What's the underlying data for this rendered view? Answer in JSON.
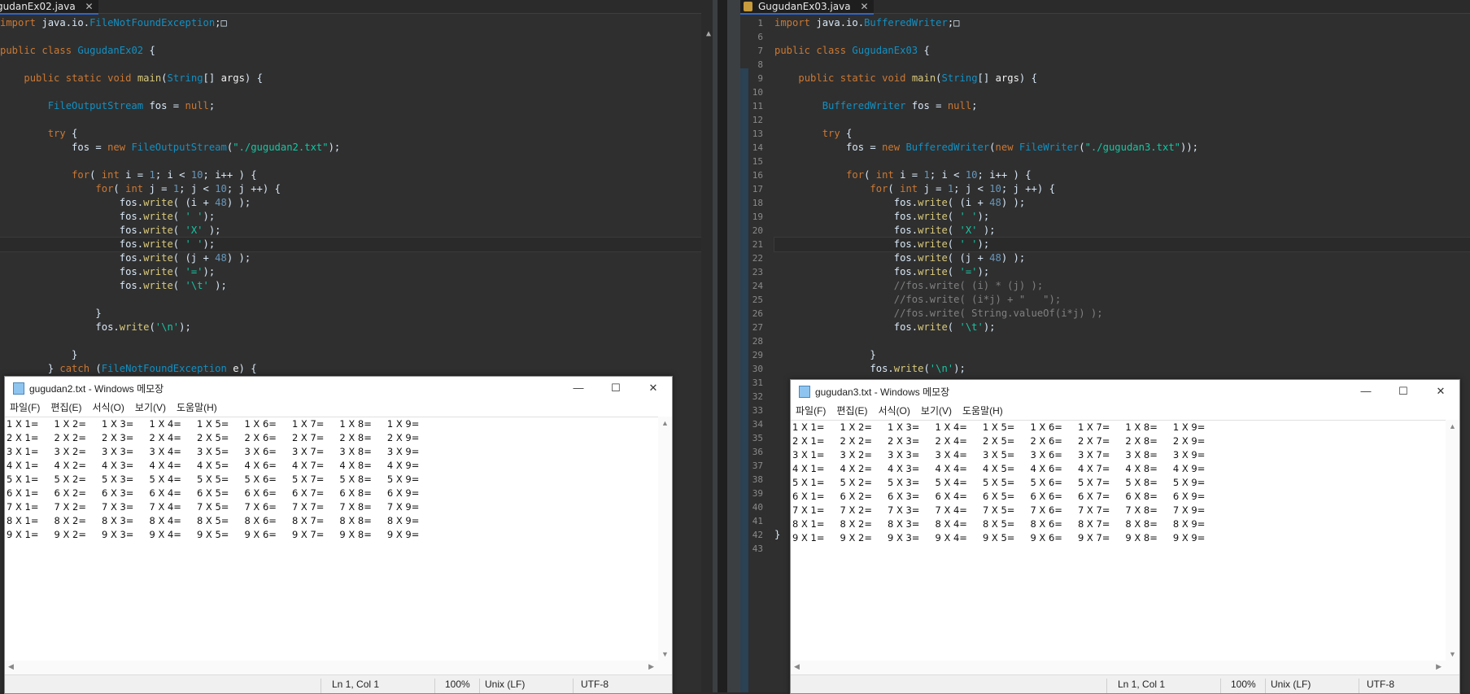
{
  "left_editor": {
    "tab_label": "gudanEx02.java",
    "lines": [
      "import java.io.FileNotFoundException;□",
      "",
      "public class GugudanEx02 {",
      "",
      "    public static void main(String[] args) {",
      "",
      "        FileOutputStream fos = null;",
      "",
      "        try {",
      "            fos = new FileOutputStream(\"./gugudan2.txt\");",
      "",
      "            for( int i = 1; i < 10; i++ ) {",
      "                for( int j = 1; j < 10; j ++) {",
      "                    fos.write( (i + 48) );",
      "                    fos.write( ' ');",
      "                    fos.write( 'X' );",
      "                    fos.write( ' ');",
      "                    fos.write( (j + 48) );",
      "                    fos.write( '=');",
      "                    fos.write( '\\t' );",
      "",
      "                }",
      "                fos.write('\\n');",
      "",
      "            }",
      "        } catch (FileNotFoundException e) {"
    ]
  },
  "right_editor": {
    "tab_label": "GugudanEx03.java",
    "line_numbers": [
      "1",
      "6",
      "7",
      "8",
      "9",
      "10",
      "11",
      "12",
      "13",
      "14",
      "15",
      "16",
      "17",
      "18",
      "19",
      "20",
      "21",
      "22",
      "23",
      "24",
      "25",
      "26",
      "27",
      "28",
      "29",
      "30",
      "31",
      "32",
      "33",
      "34",
      "35",
      "36",
      "37",
      "38",
      "39",
      "40",
      "41",
      "42",
      "43"
    ],
    "lines": [
      "import java.io.BufferedWriter;□",
      "",
      "public class GugudanEx03 {",
      "",
      "    public static void main(String[] args) {",
      "",
      "        BufferedWriter fos = null;",
      "",
      "        try {",
      "            fos = new BufferedWriter(new FileWriter(\"./gugudan3.txt\"));",
      "",
      "            for( int i = 1; i < 10; i++ ) {",
      "                for( int j = 1; j < 10; j ++) {",
      "                    fos.write( (i + 48) );",
      "                    fos.write( ' ');",
      "                    fos.write( 'X' );",
      "                    fos.write( ' ');",
      "                    fos.write( (j + 48) );",
      "                    fos.write( '=');",
      "                    //fos.write( (i) * (j) );",
      "                    //fos.write( (i*j) + \"   \");",
      "                    //fos.write( String.valueOf(i*j) );",
      "                    fos.write( '\\t');",
      "",
      "                }",
      "                fos.write('\\n');",
      "",
      "",
      "",
      "",
      "",
      "",
      "",
      "",
      "",
      "",
      "",
      "}",
      ""
    ]
  },
  "notepad_left": {
    "title": "gugudan2.txt - Windows 메모장",
    "menu": [
      "파일(F)",
      "편집(E)",
      "서식(O)",
      "보기(V)",
      "도움말(H)"
    ],
    "rows": [
      "1 X 1=\t1 X 2=\t1 X 3=\t1 X 4=\t1 X 5=\t1 X 6=\t1 X 7=\t1 X 8=\t1 X 9=",
      "2 X 1=\t2 X 2=\t2 X 3=\t2 X 4=\t2 X 5=\t2 X 6=\t2 X 7=\t2 X 8=\t2 X 9=",
      "3 X 1=\t3 X 2=\t3 X 3=\t3 X 4=\t3 X 5=\t3 X 6=\t3 X 7=\t3 X 8=\t3 X 9=",
      "4 X 1=\t4 X 2=\t4 X 3=\t4 X 4=\t4 X 5=\t4 X 6=\t4 X 7=\t4 X 8=\t4 X 9=",
      "5 X 1=\t5 X 2=\t5 X 3=\t5 X 4=\t5 X 5=\t5 X 6=\t5 X 7=\t5 X 8=\t5 X 9=",
      "6 X 1=\t6 X 2=\t6 X 3=\t6 X 4=\t6 X 5=\t6 X 6=\t6 X 7=\t6 X 8=\t6 X 9=",
      "7 X 1=\t7 X 2=\t7 X 3=\t7 X 4=\t7 X 5=\t7 X 6=\t7 X 7=\t7 X 8=\t7 X 9=",
      "8 X 1=\t8 X 2=\t8 X 3=\t8 X 4=\t8 X 5=\t8 X 6=\t8 X 7=\t8 X 8=\t8 X 9=",
      "9 X 1=\t9 X 2=\t9 X 3=\t9 X 4=\t9 X 5=\t9 X 6=\t9 X 7=\t9 X 8=\t9 X 9="
    ],
    "status": {
      "position": "Ln 1, Col 1",
      "zoom": "100%",
      "eol": "Unix (LF)",
      "encoding": "UTF-8"
    }
  },
  "notepad_right": {
    "title": "gugudan3.txt - Windows 메모장",
    "menu": [
      "파일(F)",
      "편집(E)",
      "서식(O)",
      "보기(V)",
      "도움말(H)"
    ],
    "rows": [
      "1 X 1=\t1 X 2=\t1 X 3=\t1 X 4=\t1 X 5=\t1 X 6=\t1 X 7=\t1 X 8=\t1 X 9=",
      "2 X 1=\t2 X 2=\t2 X 3=\t2 X 4=\t2 X 5=\t2 X 6=\t2 X 7=\t2 X 8=\t2 X 9=",
      "3 X 1=\t3 X 2=\t3 X 3=\t3 X 4=\t3 X 5=\t3 X 6=\t3 X 7=\t3 X 8=\t3 X 9=",
      "4 X 1=\t4 X 2=\t4 X 3=\t4 X 4=\t4 X 5=\t4 X 6=\t4 X 7=\t4 X 8=\t4 X 9=",
      "5 X 1=\t5 X 2=\t5 X 3=\t5 X 4=\t5 X 5=\t5 X 6=\t5 X 7=\t5 X 8=\t5 X 9=",
      "6 X 1=\t6 X 2=\t6 X 3=\t6 X 4=\t6 X 5=\t6 X 6=\t6 X 7=\t6 X 8=\t6 X 9=",
      "7 X 1=\t7 X 2=\t7 X 3=\t7 X 4=\t7 X 5=\t7 X 6=\t7 X 7=\t7 X 8=\t7 X 9=",
      "8 X 1=\t8 X 2=\t8 X 3=\t8 X 4=\t8 X 5=\t8 X 6=\t8 X 7=\t8 X 8=\t8 X 9=",
      "9 X 1=\t9 X 2=\t9 X 3=\t9 X 4=\t9 X 5=\t9 X 6=\t9 X 7=\t9 X 8=\t9 X 9="
    ],
    "status": {
      "position": "Ln 1, Col 1",
      "zoom": "100%",
      "eol": "Unix (LF)",
      "encoding": "UTF-8"
    }
  },
  "window_controls": {
    "minimize": "—",
    "maximize": "☐",
    "close": "✕"
  },
  "tab_close": "✕"
}
